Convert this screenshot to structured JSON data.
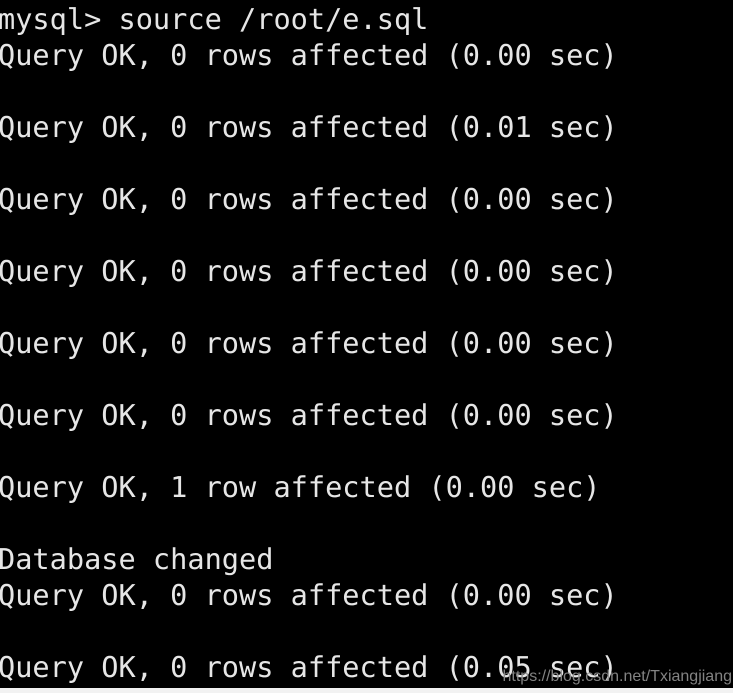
{
  "terminal": {
    "background_color": "#000000",
    "text_color": "#e6e6e6",
    "lines": [
      {
        "id": "prompt-source-command",
        "text": "mysql> source /root/e.sql"
      },
      {
        "id": "result-1",
        "text": "Query OK, 0 rows affected (0.00 sec)"
      },
      {
        "id": "spacer-1",
        "text": " "
      },
      {
        "id": "result-2",
        "text": "Query OK, 0 rows affected (0.01 sec)"
      },
      {
        "id": "spacer-2",
        "text": " "
      },
      {
        "id": "result-3",
        "text": "Query OK, 0 rows affected (0.00 sec)"
      },
      {
        "id": "spacer-3",
        "text": " "
      },
      {
        "id": "result-4",
        "text": "Query OK, 0 rows affected (0.00 sec)"
      },
      {
        "id": "spacer-4",
        "text": " "
      },
      {
        "id": "result-5",
        "text": "Query OK, 0 rows affected (0.00 sec)"
      },
      {
        "id": "spacer-5",
        "text": " "
      },
      {
        "id": "result-6",
        "text": "Query OK, 0 rows affected (0.00 sec)"
      },
      {
        "id": "spacer-6",
        "text": " "
      },
      {
        "id": "result-7",
        "text": "Query OK, 1 row affected (0.00 sec)"
      },
      {
        "id": "spacer-7",
        "text": " "
      },
      {
        "id": "database-changed",
        "text": "Database changed"
      },
      {
        "id": "result-8",
        "text": "Query OK, 0 rows affected (0.00 sec)"
      },
      {
        "id": "spacer-8",
        "text": " "
      },
      {
        "id": "result-9",
        "text": "Query OK, 0 rows affected (0.05 sec)"
      }
    ]
  },
  "watermark": {
    "text": "https://blog.csdn.net/Txiangjiang",
    "color": "#8f8f8f"
  }
}
